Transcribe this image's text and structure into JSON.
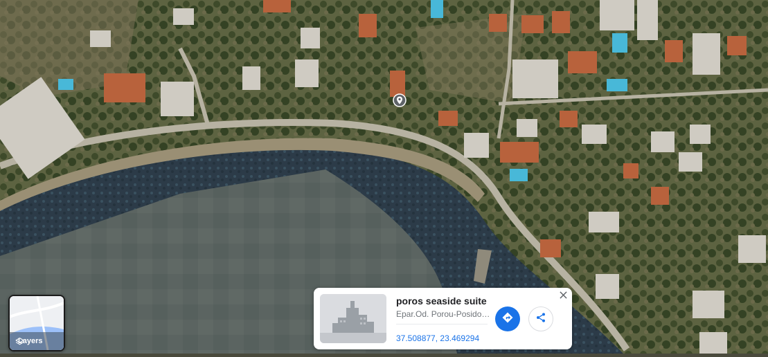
{
  "map": {
    "view": "satellite",
    "pin_icon": "location-pin-icon"
  },
  "layers_button": {
    "label": "Layers",
    "icon": "layers-icon"
  },
  "place_card": {
    "title": "poros seaside suite",
    "address": "Epar.Od. Porou-Posidoniou",
    "coordinates": "37.508877, 23.469294",
    "thumbnail": "place-thumbnail",
    "directions_icon": "directions-icon",
    "share_icon": "share-icon",
    "close_icon": "close-icon",
    "accent_color": "#1a73e8"
  }
}
